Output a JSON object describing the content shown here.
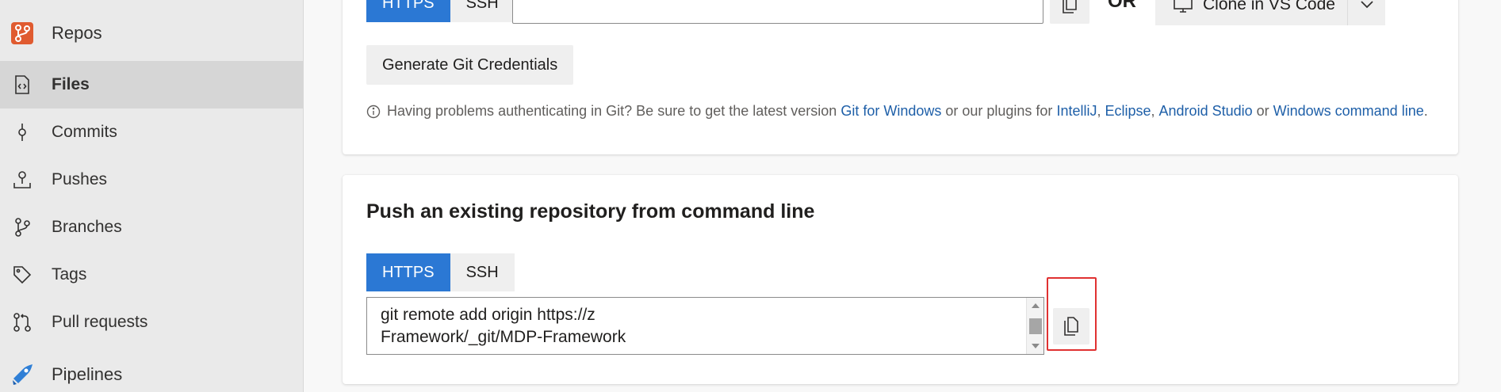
{
  "sidebar": {
    "items": [
      {
        "label": "Repos",
        "icon": "repos-icon"
      },
      {
        "label": "Files",
        "icon": "file-code-icon"
      },
      {
        "label": "Commits",
        "icon": "commit-icon"
      },
      {
        "label": "Pushes",
        "icon": "push-icon"
      },
      {
        "label": "Branches",
        "icon": "branch-icon"
      },
      {
        "label": "Tags",
        "icon": "tag-icon"
      },
      {
        "label": "Pull requests",
        "icon": "pull-request-icon"
      },
      {
        "label": "Pipelines",
        "icon": "pipelines-icon"
      }
    ],
    "active": "Files"
  },
  "clone": {
    "tabs": [
      "HTTPS",
      "SSH"
    ],
    "selected_tab": "HTTPS",
    "or_label": "OR",
    "clone_vs_code_label": "Clone in VS Code",
    "generate_credentials_label": "Generate Git Credentials",
    "info": {
      "prefix": "Having problems authenticating in Git? Be sure to get the latest version ",
      "link_git_windows": "Git for Windows",
      "middle": " or our plugins for ",
      "link_intellij": "IntelliJ",
      "comma1": ", ",
      "link_eclipse": "Eclipse",
      "comma2": ", ",
      "link_android": "Android Studio",
      "or_text": " or ",
      "link_windows_cmd": "Windows command line",
      "suffix": "."
    }
  },
  "push": {
    "title": "Push an existing repository from command line",
    "tabs": [
      "HTTPS",
      "SSH"
    ],
    "selected_tab": "HTTPS",
    "code_lines": [
      "git remote add origin https://z",
      "Framework/_git/MDP-Framework"
    ]
  },
  "colors": {
    "accent": "#2b78d4",
    "link": "#1e5fa8",
    "highlight": "#e03131",
    "repos_brand": "#e05b30",
    "pipelines_brand": "#2f7fd6"
  }
}
